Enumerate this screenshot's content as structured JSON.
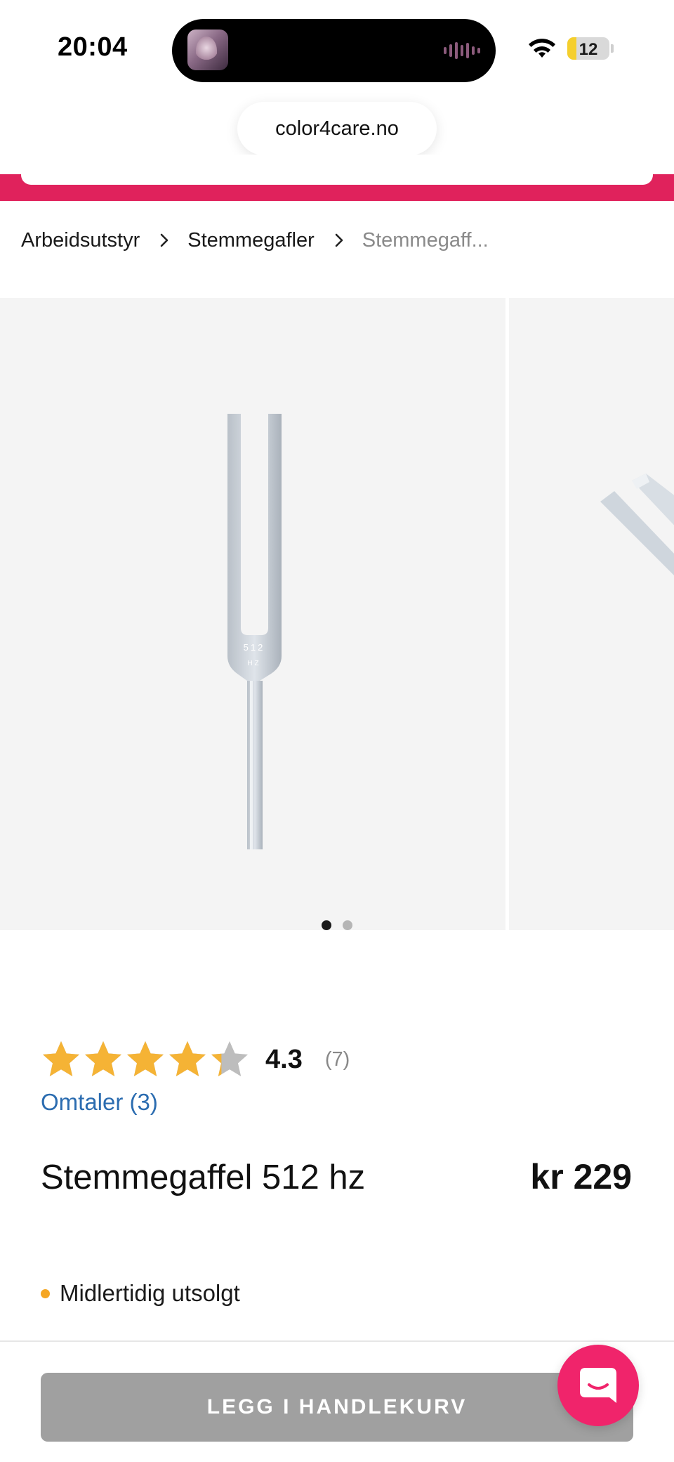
{
  "status_bar": {
    "time": "20:04",
    "battery_level": "12",
    "battery_fraction": 0.12
  },
  "browser": {
    "url": "color4care.no"
  },
  "colors": {
    "brand_pink": "#e0225c",
    "link_blue": "#2b6cb0",
    "star_gold": "#f5b335",
    "stock_orange": "#f5a623",
    "disabled_gray": "#a0a0a0",
    "chat_pink": "#f0246b"
  },
  "breadcrumb": {
    "items": [
      "Arbeidsutstyr",
      "Stemmegafler"
    ],
    "current": "Stemmegaff..."
  },
  "gallery": {
    "slide_count": 2,
    "active_index": 0,
    "fork_engraving_line1": "512",
    "fork_engraving_line2": "HZ"
  },
  "rating": {
    "value": "4.3",
    "score": 4.3,
    "max": 5,
    "count": "(7)",
    "reviews_link": "Omtaler (3)"
  },
  "product": {
    "title": "Stemmegaffel 512 hz",
    "price": "kr 229"
  },
  "stock": {
    "status": "Midlertidig utsolgt"
  },
  "actions": {
    "add_to_cart": "LEGG I HANDLEKURV"
  },
  "icons": {
    "breadcrumb_separator": "chevron-right-icon",
    "star": "star-icon",
    "chat": "chat-icon",
    "wifi": "wifi-icon"
  }
}
